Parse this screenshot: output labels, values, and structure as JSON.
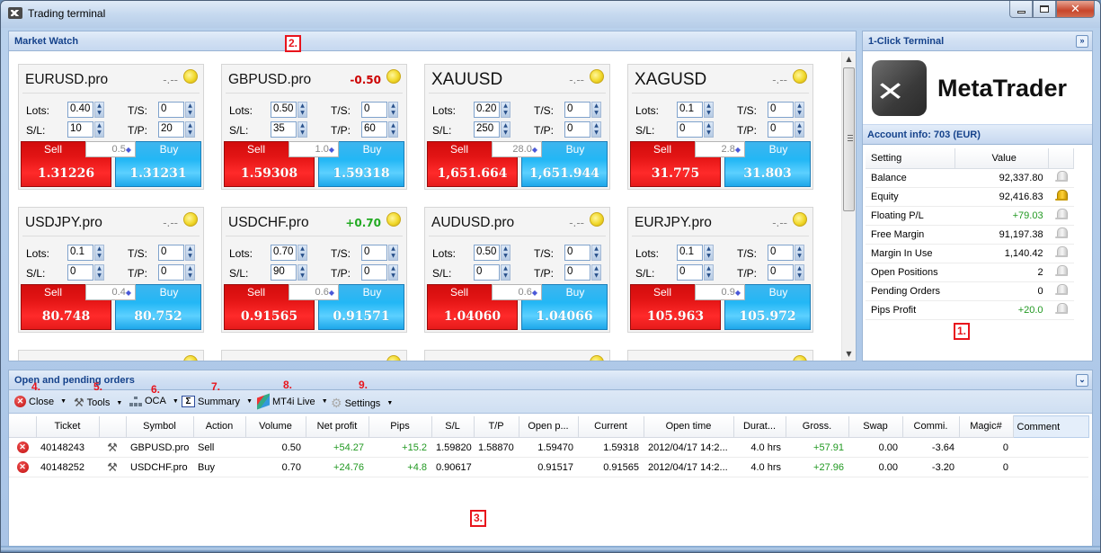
{
  "window": {
    "title": "Trading terminal"
  },
  "market_watch": {
    "title": "Market Watch",
    "labels": {
      "lots": "Lots:",
      "sl": "S/L:",
      "ts": "T/S:",
      "tp": "T/P:",
      "sell": "Sell",
      "buy": "Buy"
    },
    "tiles": [
      {
        "symbol": "EURUSD.pro",
        "pl": "-.--",
        "pl_state": "none",
        "lots": "0.40",
        "sl": "10",
        "ts": "0",
        "tp": "20",
        "spread": "0.5",
        "sell": "1.31226",
        "buy": "1.31231"
      },
      {
        "symbol": "GBPUSD.pro",
        "pl": "-0.50",
        "pl_state": "neg",
        "lots": "0.50",
        "sl": "35",
        "ts": "0",
        "tp": "60",
        "spread": "1.0",
        "sell": "1.59308",
        "buy": "1.59318"
      },
      {
        "symbol": "XAUUSD",
        "pl": "-.--",
        "pl_state": "none",
        "lots": "0.20",
        "sl": "250",
        "ts": "0",
        "tp": "0",
        "spread": "28.0",
        "sell": "1,651.664",
        "buy": "1,651.944"
      },
      {
        "symbol": "XAGUSD",
        "pl": "-.--",
        "pl_state": "none",
        "lots": "0.1",
        "sl": "0",
        "ts": "0",
        "tp": "0",
        "spread": "2.8",
        "sell": "31.775",
        "buy": "31.803"
      },
      {
        "symbol": "USDJPY.pro",
        "pl": "-.--",
        "pl_state": "none",
        "lots": "0.1",
        "sl": "0",
        "ts": "0",
        "tp": "0",
        "spread": "0.4",
        "sell": "80.748",
        "buy": "80.752"
      },
      {
        "symbol": "USDCHF.pro",
        "pl": "+0.70",
        "pl_state": "pos",
        "lots": "0.70",
        "sl": "90",
        "ts": "0",
        "tp": "0",
        "spread": "0.6",
        "sell": "0.91565",
        "buy": "0.91571"
      },
      {
        "symbol": "AUDUSD.pro",
        "pl": "-.--",
        "pl_state": "none",
        "lots": "0.50",
        "sl": "0",
        "ts": "0",
        "tp": "0",
        "spread": "0.6",
        "sell": "1.04060",
        "buy": "1.04066"
      },
      {
        "symbol": "EURJPY.pro",
        "pl": "-.--",
        "pl_state": "none",
        "lots": "0.1",
        "sl": "0",
        "ts": "0",
        "tp": "0",
        "spread": "0.9",
        "sell": "105.963",
        "buy": "105.972"
      }
    ]
  },
  "one_click": {
    "title": "1-Click Terminal",
    "logo_text": "MetaTrader",
    "account_header": "Account info: 703 (EUR)",
    "columns": [
      "Setting",
      "Value"
    ],
    "rows": [
      {
        "setting": "Balance",
        "value": "92,337.80",
        "positive": false,
        "bell_active": false
      },
      {
        "setting": "Equity",
        "value": "92,416.83",
        "positive": false,
        "bell_active": true
      },
      {
        "setting": "Floating P/L",
        "value": "+79.03",
        "positive": true,
        "bell_active": false
      },
      {
        "setting": "Free Margin",
        "value": "91,197.38",
        "positive": false,
        "bell_active": false
      },
      {
        "setting": "Margin In Use",
        "value": "1,140.42",
        "positive": false,
        "bell_active": false
      },
      {
        "setting": "Open Positions",
        "value": "2",
        "positive": false,
        "bell_active": false
      },
      {
        "setting": "Pending Orders",
        "value": "0",
        "positive": false,
        "bell_active": false
      },
      {
        "setting": "Pips Profit",
        "value": "+20.0",
        "positive": true,
        "bell_active": false
      }
    ]
  },
  "orders": {
    "title": "Open and pending orders",
    "toolbar": [
      {
        "label": "Close",
        "icon": "close-circle-icon"
      },
      {
        "label": "Tools",
        "icon": "tools-icon"
      },
      {
        "label": "OCA",
        "icon": "hierarchy-icon"
      },
      {
        "label": "Summary",
        "icon": "sigma-icon"
      },
      {
        "label": "MT4i Live",
        "icon": "mt4i-icon"
      },
      {
        "label": "Settings",
        "icon": "gear-icon"
      }
    ],
    "columns": [
      "",
      "Ticket",
      "",
      "Symbol",
      "Action",
      "Volume",
      "Net profit",
      "Pips",
      "S/L",
      "T/P",
      "Open p...",
      "Current",
      "Open time",
      "Durat...",
      "Gross.",
      "Swap",
      "Commi.",
      "Magic#",
      "Comment"
    ],
    "rows": [
      {
        "ticket": "40148243",
        "symbol": "GBPUSD.pro",
        "action": "Sell",
        "volume": "0.50",
        "net_profit": "+54.27",
        "pips": "+15.2",
        "sl": "1.59820",
        "tp": "1.58870",
        "open_price": "1.59470",
        "current": "1.59318",
        "open_time": "2012/04/17 14:2...",
        "duration": "4.0 hrs",
        "gross": "+57.91",
        "swap": "0.00",
        "commission": "-3.64",
        "magic": "0",
        "comment": ""
      },
      {
        "ticket": "40148252",
        "symbol": "USDCHF.pro",
        "action": "Buy",
        "volume": "0.70",
        "net_profit": "+24.76",
        "pips": "+4.8",
        "sl": "0.90617",
        "tp": "",
        "open_price": "0.91517",
        "current": "0.91565",
        "open_time": "2012/04/17 14:2...",
        "duration": "4.0 hrs",
        "gross": "+27.96",
        "swap": "0.00",
        "commission": "-3.20",
        "magic": "0",
        "comment": ""
      }
    ]
  },
  "annotations": [
    "1.",
    "2.",
    "3.",
    "4.",
    "5.",
    "6.",
    "7.",
    "8.",
    "9."
  ],
  "colors": {
    "sell": "#e41515",
    "buy": "#23b7f5",
    "positive": "#229922",
    "negative": "#cc0000",
    "header_text": "#15428b"
  }
}
